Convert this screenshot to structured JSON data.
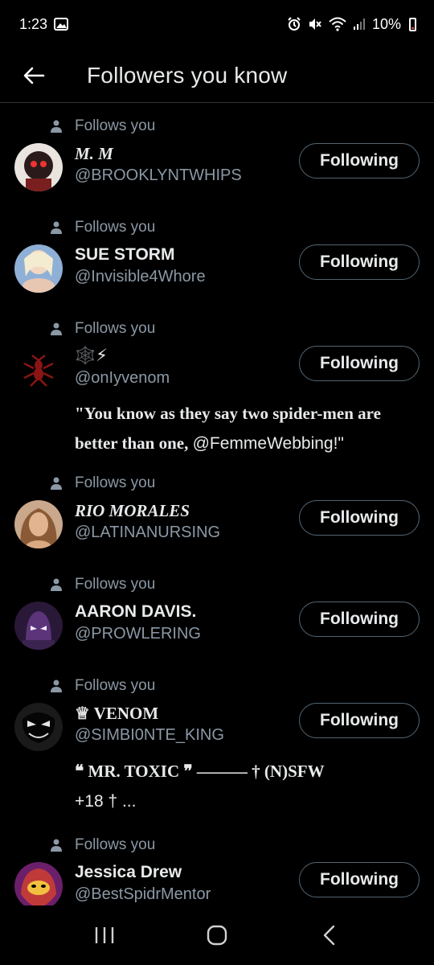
{
  "status_bar": {
    "time": "1:23",
    "battery": "10%"
  },
  "header": {
    "title": "Followers you know"
  },
  "follows_label": "Follows you",
  "follow_button_label": "Following",
  "accounts": [
    {
      "name": "M. M",
      "handle": "@BROOKLYNTWHIPS",
      "bio": "",
      "avatar_color": "#7a1f1f"
    },
    {
      "name": "SUE STORM",
      "handle": "@Invisible4Whore",
      "bio": "",
      "avatar_color": "#9fb7d8"
    },
    {
      "name": "🕸️⚡",
      "handle": "@onIyvenom",
      "bio_text": "\"You know as they say two spider-men are better than one, ",
      "bio_mention": "@FemmeWebbing!\"",
      "avatar_color": "#1a0a0a"
    },
    {
      "name": "RIO MORALES",
      "handle": "@LATINANURSING",
      "bio": "",
      "avatar_color": "#b88562"
    },
    {
      "name": "AARON DAVIS.",
      "handle": "@PROWLERING",
      "bio": "",
      "avatar_color": "#3b2350"
    },
    {
      "name": "♕ VENOM",
      "handle": "@SIMBI0NTE_KING",
      "bio_line1": "❝ MR. TOXIC ❞ ——— † (N)SFW",
      "bio_line2": "+18 † ...",
      "avatar_color": "#1c1c1c"
    },
    {
      "name": "Jessica Drew",
      "handle": "@BestSpidrMentor",
      "bio": "",
      "avatar_color": "#c03a3a"
    }
  ],
  "colors": {
    "background": "#000000",
    "secondary_text": "#8b98a5",
    "button_border": "#536471"
  }
}
